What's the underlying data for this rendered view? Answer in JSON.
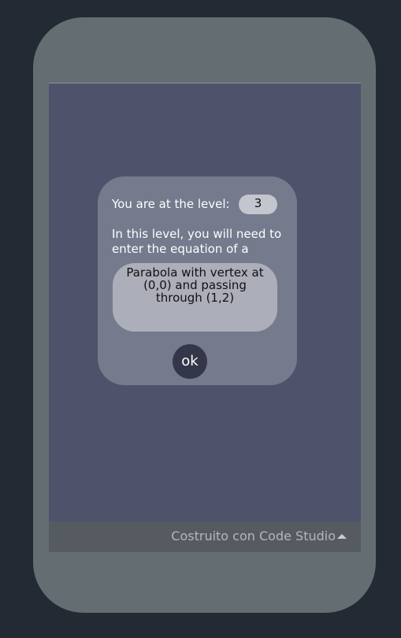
{
  "dialog": {
    "level_label": "You are at the level:",
    "level_value": "3",
    "instruction": "In this level, you will need to enter the equation of a",
    "equation": "Parabola with vertex at (0,0) and passing through (1,2)",
    "ok_label": "ok"
  },
  "footer": {
    "text": "Costruito con Code Studio",
    "arrow_icon": "caret-up-icon"
  },
  "colors": {
    "page_background": "#232a33",
    "phone_frame": "#646e72",
    "screen_background": "#4e536b",
    "dialog_background": "#757a8d",
    "equation_box": "#acaeb9",
    "level_badge": "#c3c5cf",
    "ok_button": "#333749",
    "footer_bar": "#565b62"
  }
}
